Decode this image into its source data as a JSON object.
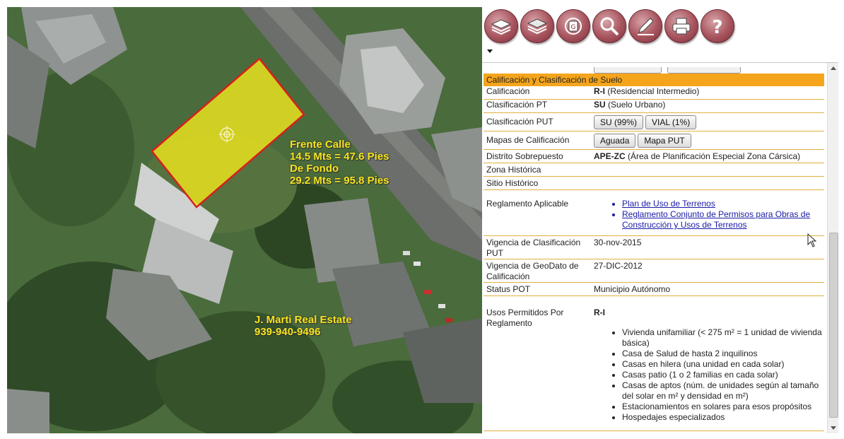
{
  "map": {
    "annotation_lot": {
      "line1": "Frente Calle",
      "line2": "14.5 Mts = 47.6 Pies",
      "line3": "De Fondo",
      "line4": "29.2 Mts = 95.8 Pies"
    },
    "annotation_contact": {
      "name": "J. Marti Real Estate",
      "phone": "939-940-9496"
    },
    "colors": {
      "parcel_fill": "#e8e11e",
      "parcel_border": "#d81e1e",
      "annotation": "#f5e51c"
    }
  },
  "toolbar": {
    "tools": [
      "layers-icon",
      "base-map-icon",
      "gps-icon",
      "search-icon",
      "draw-icon",
      "print-icon",
      "help-icon"
    ]
  },
  "panel": {
    "section_title": "Calificación y Clasificación de Suelo",
    "rows": {
      "calificacion": {
        "label": "Calificación",
        "code": "R-I",
        "desc": "(Residencial Intermedio)"
      },
      "clasificacion_pt": {
        "label": "Clasificación PT",
        "code": "SU",
        "desc": "(Suelo Urbano)"
      },
      "clasificacion_put": {
        "label": "Clasificación PUT",
        "button1": "SU (99%)",
        "button2": "VIAL (1%)"
      },
      "mapas": {
        "label": "Mapas de Calificación",
        "button1": "Aguada",
        "button2": "Mapa PUT"
      },
      "distrito": {
        "label": "Distrito Sobrepuesto",
        "code": "APE-ZC",
        "desc": "(Área de Planificación Especial Zona Cársica)"
      },
      "zona_historica": {
        "label": "Zona Histórica"
      },
      "sitio_historico": {
        "label": "Sitio Histórico"
      },
      "reglamento": {
        "label": "Reglamento Aplicable",
        "links": [
          "Plan de Uso de Terrenos",
          "Reglamento Conjunto de Permisos para Obras de Construcción y Usos de Terrenos"
        ]
      },
      "vigencia_put": {
        "label": "Vigencia de Clasificación PUT",
        "value": "30-nov-2015"
      },
      "vigencia_geodato": {
        "label": "Vigencia de GeoDato de Calificación",
        "value": "27-DIC-2012"
      },
      "status_pot": {
        "label": "Status POT",
        "value": "Municipio Autónomo"
      },
      "usos": {
        "label": "Usos Permitidos Por Reglamento",
        "code": "R-I",
        "items": [
          "Vivienda unifamiliar (< 275 m² = 1 unidad de vivienda básica)",
          "Casa de Salud de hasta 2 inquilinos",
          "Casas en hilera (una unidad en cada solar)",
          "Casas patio (1 o 2 familias en cada solar)",
          "Casas de aptos (núm. de unidades según al tamaño del solar en m² y densidad en m²)",
          "Estacionamientos en solares para esos propósitos",
          "Hospedajes especializados"
        ]
      }
    },
    "colors": {
      "header": "#f5a51c",
      "row_border": "#e0b040",
      "link": "#1a1aa8"
    }
  }
}
